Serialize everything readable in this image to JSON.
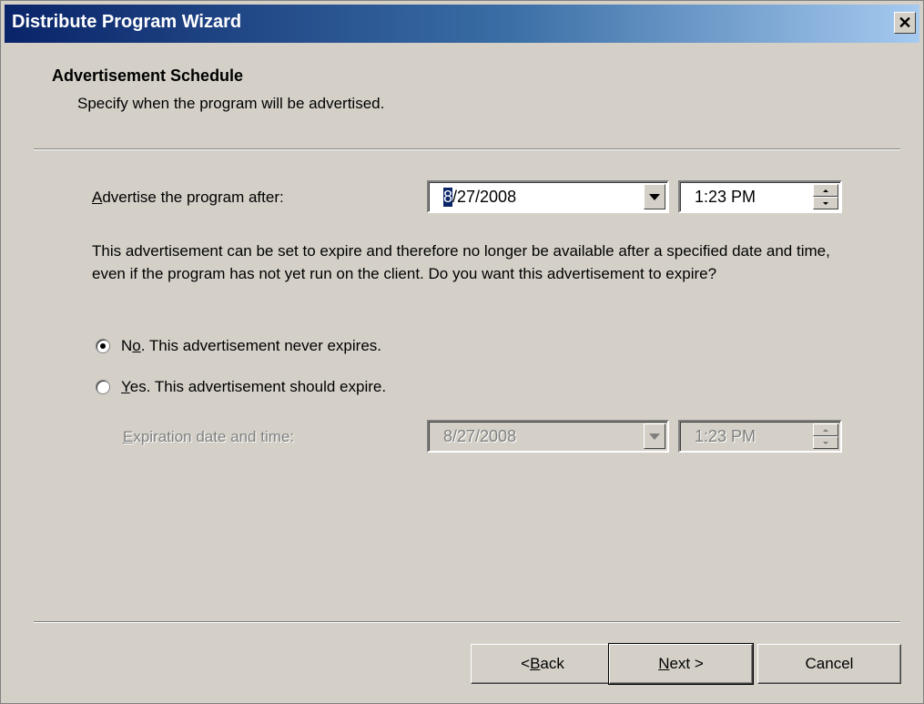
{
  "window": {
    "title": "Distribute Program Wizard",
    "close_glyph": "✕"
  },
  "header": {
    "title": "Advertisement Schedule",
    "subtitle": "Specify when the program will be advertised."
  },
  "advertise": {
    "label_accel": "A",
    "label_rest": "dvertise the program after:",
    "date_first": "8",
    "date_rest": "/27/2008",
    "time": "1:23 PM"
  },
  "description": "This advertisement can be set to expire and therefore no longer be available after a specified date and time, even if the program has not yet run on the client. Do you want this advertisement to expire?",
  "options": {
    "no_pre": "N",
    "no_accel": "o",
    "no_rest": ". This advertisement never expires.",
    "yes_accel": "Y",
    "yes_rest": "es. This advertisement should expire."
  },
  "expiration": {
    "label_accel": "E",
    "label_rest": "xpiration date and time:",
    "date": "8/27/2008",
    "time": "1:23 PM"
  },
  "buttons": {
    "back_pre": "< ",
    "back_accel": "B",
    "back_rest": "ack",
    "next_accel": "N",
    "next_rest": "ext >",
    "cancel": "Cancel"
  }
}
